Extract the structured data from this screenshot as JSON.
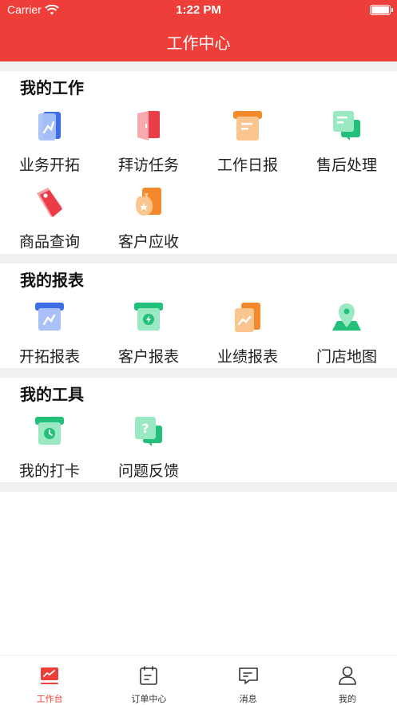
{
  "status_bar": {
    "carrier": "Carrier",
    "time": "1:22 PM"
  },
  "nav": {
    "title": "工作中心"
  },
  "sections": [
    {
      "title": "我的工作",
      "items": [
        {
          "label": "业务开拓",
          "icon": "business-expansion-icon"
        },
        {
          "label": "拜访任务",
          "icon": "visit-task-icon"
        },
        {
          "label": "工作日报",
          "icon": "daily-report-icon"
        },
        {
          "label": "售后处理",
          "icon": "after-sales-icon"
        },
        {
          "label": "商品查询",
          "icon": "product-tag-icon"
        },
        {
          "label": "客户应收",
          "icon": "money-bag-icon"
        }
      ]
    },
    {
      "title": "我的报表",
      "items": [
        {
          "label": "开拓报表",
          "icon": "expansion-report-icon"
        },
        {
          "label": "客户报表",
          "icon": "customer-report-icon"
        },
        {
          "label": "业绩报表",
          "icon": "performance-report-icon"
        },
        {
          "label": "门店地图",
          "icon": "store-map-icon"
        }
      ]
    },
    {
      "title": "我的工具",
      "items": [
        {
          "label": "我的打卡",
          "icon": "clock-in-icon"
        },
        {
          "label": "问题反馈",
          "icon": "feedback-icon"
        }
      ]
    }
  ],
  "tabbar": {
    "items": [
      {
        "label": "工作台",
        "icon": "dashboard-icon",
        "active": true
      },
      {
        "label": "订单中心",
        "icon": "order-center-icon",
        "active": false
      },
      {
        "label": "消息",
        "icon": "message-icon",
        "active": false
      },
      {
        "label": "我的",
        "icon": "profile-icon",
        "active": false
      }
    ]
  },
  "colors": {
    "brand": "#ee3e3a",
    "section_gap": "#f0f0f0"
  }
}
